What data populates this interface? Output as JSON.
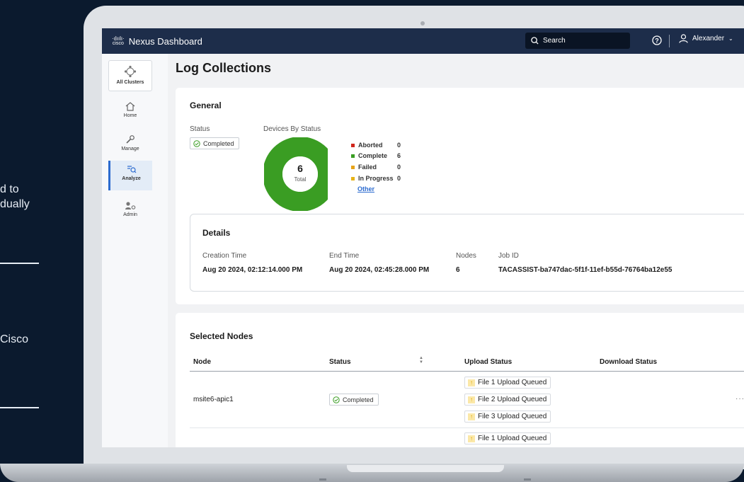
{
  "side_text": {
    "line1": "d to",
    "line2": "dually",
    "line3": "Cisco"
  },
  "topbar": {
    "logo_text": "cisco",
    "app_name": "Nexus Dashboard",
    "search_label": "Search",
    "user_name": "Alexander",
    "bg_color": "#1d2d4a"
  },
  "nav": {
    "items": [
      {
        "label": "All Clusters",
        "icon": "cluster-icon"
      },
      {
        "label": "Home",
        "icon": "home-icon"
      },
      {
        "label": "Manage",
        "icon": "wrench-icon"
      },
      {
        "label": "Analyze",
        "icon": "analyze-icon",
        "active": true
      },
      {
        "label": "Admin",
        "icon": "admin-icon"
      }
    ]
  },
  "page": {
    "title": "Log Collections"
  },
  "general": {
    "heading": "General",
    "status_label": "Status",
    "status_value": "Completed",
    "devices_label": "Devices By Status",
    "donut_total": "6",
    "donut_total_label": "Total",
    "legend": [
      {
        "label": "Aborted",
        "count": "0",
        "color": "#d0261c"
      },
      {
        "label": "Complete",
        "count": "6",
        "color": "#3a9d23"
      },
      {
        "label": "Failed",
        "count": "0",
        "color": "#e7a318"
      },
      {
        "label": "In Progress",
        "count": "0",
        "color": "#e7b318"
      }
    ],
    "other_link": "Other"
  },
  "details": {
    "heading": "Details",
    "creation_label": "Creation Time",
    "creation_value": "Aug 20 2024, 02:12:14.000 PM",
    "end_label": "End Time",
    "end_value": "Aug 20 2024, 02:45:28.000 PM",
    "nodes_label": "Nodes",
    "nodes_value": "6",
    "job_label": "Job ID",
    "job_value": "TACASSIST-ba747dac-5f1f-11ef-b55d-76764ba12e55"
  },
  "selected_nodes": {
    "heading": "Selected Nodes",
    "columns": [
      "Node",
      "Status",
      "Upload Status",
      "Download Status"
    ],
    "rows": [
      {
        "node": "msite6-apic1",
        "status": "Completed",
        "uploads": [
          "File 1 Upload Queued",
          "File 2 Upload Queued",
          "File 3 Upload Queued"
        ],
        "download": ""
      },
      {
        "node": "",
        "status": "",
        "uploads": [
          "File 1 Upload Queued"
        ],
        "download": ""
      }
    ],
    "row_menu": "···"
  }
}
